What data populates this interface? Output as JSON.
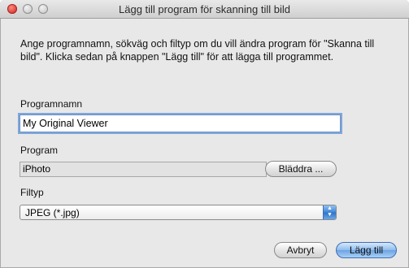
{
  "window": {
    "title": "Lägg till program för skanning till bild"
  },
  "description": "Ange programnamn, sökväg och filtyp om du vill ändra program för \"Skanna till bild\". Klicka sedan på knappen \"Lägg till\" för att lägga till programmet.",
  "program_name": {
    "label": "Programnamn",
    "value": "My Original Viewer"
  },
  "program": {
    "label": "Program",
    "value": "iPhoto",
    "browse_label": "Bläddra ..."
  },
  "filetype": {
    "label": "Filtyp",
    "selected": "JPEG (*.jpg)"
  },
  "buttons": {
    "cancel": "Avbryt",
    "add": "Lägg till"
  }
}
